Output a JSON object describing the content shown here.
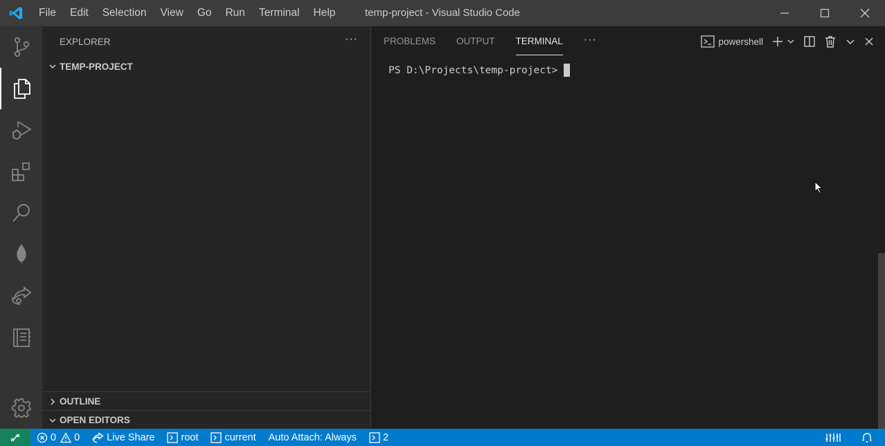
{
  "window": {
    "title": "temp-project - Visual Studio Code",
    "menu": [
      "File",
      "Edit",
      "Selection",
      "View",
      "Go",
      "Run",
      "Terminal",
      "Help"
    ]
  },
  "activity_bar": {
    "items": [
      "source-control-icon",
      "explorer-icon",
      "run-debug-icon",
      "extensions-icon",
      "search-icon",
      "mongodb-leaf-icon",
      "live-share-icon",
      "notebook-icon"
    ],
    "active": "explorer-icon",
    "bottom": "gear-icon"
  },
  "sidebar": {
    "title": "EXPLORER",
    "more_label": "···",
    "folder": "TEMP-PROJECT",
    "outline": "OUTLINE",
    "open_editors": "OPEN EDITORS"
  },
  "panel": {
    "tabs": [
      "PROBLEMS",
      "OUTPUT",
      "TERMINAL"
    ],
    "active_tab": "TERMINAL",
    "more_label": "···",
    "shell": "powershell",
    "prompt": "PS D:\\Projects\\temp-project>"
  },
  "statusbar": {
    "errors": "0",
    "warnings": "0",
    "live_share": "Live Share",
    "terminal_root": "root",
    "terminal_current": "current",
    "auto_attach": "Auto Attach: Always",
    "terminal_count": "2"
  },
  "colors": {
    "titlebar": "#3c3c3c",
    "activitybar": "#333333",
    "sidebar": "#252526",
    "editor": "#1e1e1e",
    "statusbar": "#007acc",
    "remote": "#16825d",
    "vscode_blue": "#23a9f2"
  }
}
